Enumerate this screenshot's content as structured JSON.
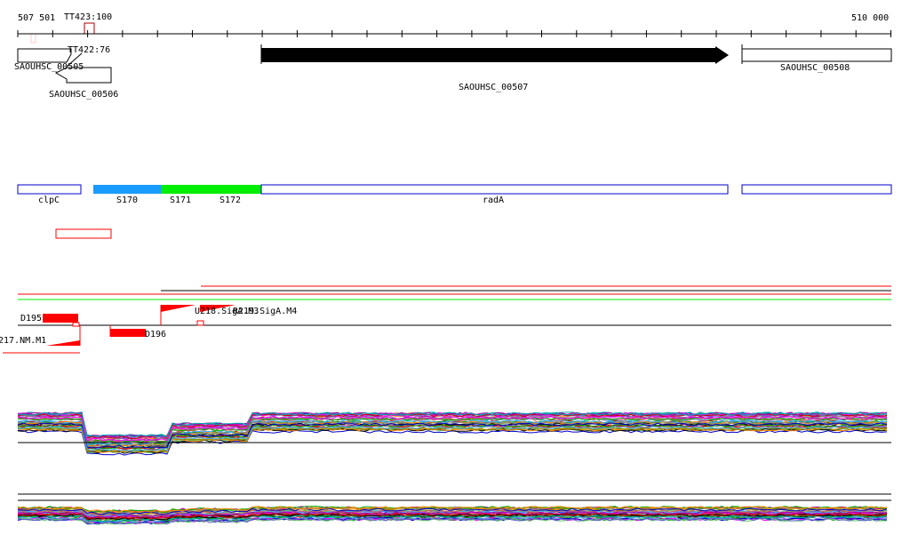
{
  "ruler": {
    "start": "507 501",
    "end": "510 000",
    "tss_top": "TT423:100",
    "tss_bottom": "TT422:76"
  },
  "genes": [
    {
      "name": "SAOUHSC_00505"
    },
    {
      "name": "SAOUHSC_00506"
    },
    {
      "name": "SAOUHSC_00507"
    },
    {
      "name": "SAOUHSC_00508"
    }
  ],
  "segments": [
    {
      "name": "clpC",
      "color": "#ffffff"
    },
    {
      "name": "S170",
      "color": "#1a9bff"
    },
    {
      "name": "S171",
      "color": "#00ee00"
    },
    {
      "name": "S172",
      "color": "#00ee00"
    },
    {
      "name": "radA",
      "color": "#ffffff"
    }
  ],
  "motifs": {
    "d195": "D195",
    "d196": "D196",
    "m1": "217.NM.M1",
    "m3": "U218.SigA.M3",
    "m4": "R219.SigA.M4"
  },
  "colors": {
    "accent": "#ff0000",
    "green": "#00ee00",
    "blue": "#1a9bff",
    "outline": "#0000cc"
  }
}
